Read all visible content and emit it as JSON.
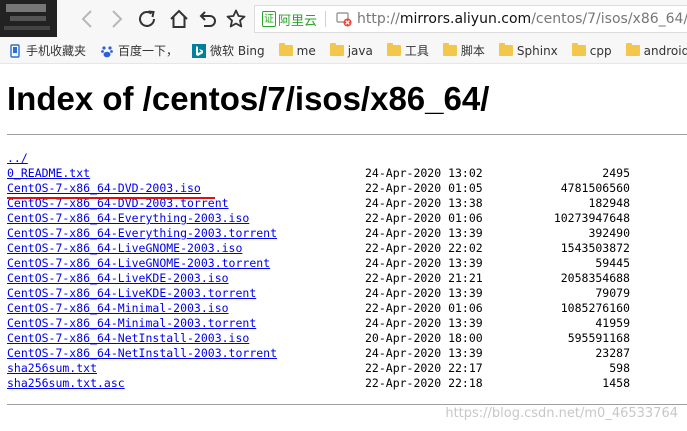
{
  "browser": {
    "address": {
      "site_badge": "阿里云",
      "url_scheme": "http://",
      "url_host": "mirrors.aliyun.com",
      "url_path": "/centos/7/isos/x86_64/"
    },
    "bookmarks": [
      {
        "label": "手机收藏夹",
        "icon": "mobile-bookmarks-icon"
      },
      {
        "label": "百度一下，",
        "icon": "baidu-icon"
      },
      {
        "label": "微软 Bing",
        "icon": "bing-icon"
      },
      {
        "label": "me",
        "icon": "folder-icon"
      },
      {
        "label": "java",
        "icon": "folder-icon"
      },
      {
        "label": "工具",
        "icon": "folder-icon"
      },
      {
        "label": "脚本",
        "icon": "folder-icon"
      },
      {
        "label": "Sphinx",
        "icon": "folder-icon"
      },
      {
        "label": "cpp",
        "icon": "folder-icon"
      },
      {
        "label": "android",
        "icon": "folder-icon"
      }
    ]
  },
  "page": {
    "title": "Index of /centos/7/isos/x86_64/",
    "files": [
      {
        "name": "../",
        "date": "",
        "size": ""
      },
      {
        "name": "0_README.txt",
        "date": "24-Apr-2020 13:02",
        "size": "2495"
      },
      {
        "name": "CentOS-7-x86_64-DVD-2003.iso",
        "date": "22-Apr-2020 01:05",
        "size": "4781506560"
      },
      {
        "name": "CentOS-7-x86_64-DVD-2003.torrent",
        "date": "24-Apr-2020 13:38",
        "size": "182948"
      },
      {
        "name": "CentOS-7-x86_64-Everything-2003.iso",
        "date": "22-Apr-2020 01:06",
        "size": "10273947648"
      },
      {
        "name": "CentOS-7-x86_64-Everything-2003.torrent",
        "date": "24-Apr-2020 13:39",
        "size": "392490"
      },
      {
        "name": "CentOS-7-x86_64-LiveGNOME-2003.iso",
        "date": "22-Apr-2020 22:02",
        "size": "1543503872"
      },
      {
        "name": "CentOS-7-x86_64-LiveGNOME-2003.torrent",
        "date": "24-Apr-2020 13:39",
        "size": "59445"
      },
      {
        "name": "CentOS-7-x86_64-LiveKDE-2003.iso",
        "date": "22-Apr-2020 21:21",
        "size": "2058354688"
      },
      {
        "name": "CentOS-7-x86_64-LiveKDE-2003.torrent",
        "date": "24-Apr-2020 13:39",
        "size": "79079"
      },
      {
        "name": "CentOS-7-x86_64-Minimal-2003.iso",
        "date": "22-Apr-2020 01:06",
        "size": "1085276160"
      },
      {
        "name": "CentOS-7-x86_64-Minimal-2003.torrent",
        "date": "24-Apr-2020 13:39",
        "size": "41959"
      },
      {
        "name": "CentOS-7-x86_64-NetInstall-2003.iso",
        "date": "20-Apr-2020 18:00",
        "size": "595591168"
      },
      {
        "name": "CentOS-7-x86_64-NetInstall-2003.torrent",
        "date": "24-Apr-2020 13:39",
        "size": "23287"
      },
      {
        "name": "sha256sum.txt",
        "date": "22-Apr-2020 22:17",
        "size": "598"
      },
      {
        "name": "sha256sum.txt.asc",
        "date": "22-Apr-2020 22:18",
        "size": "1458"
      }
    ]
  },
  "watermark": "https://blog.csdn.net/m0_46533764",
  "colors": {
    "link": "#0000ee",
    "underline_mark": "#dd1111",
    "secure_badge": "#27a427"
  }
}
